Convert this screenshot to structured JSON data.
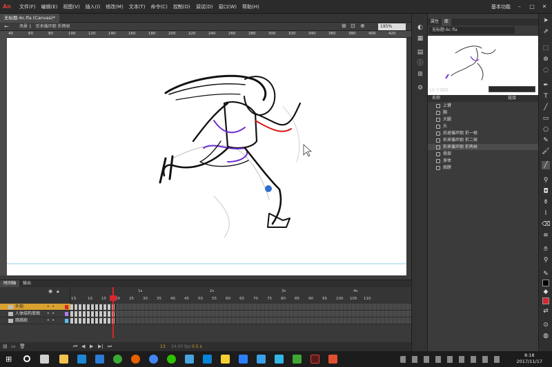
{
  "app": {
    "logo": "An"
  },
  "menu": [
    "文件(F)",
    "编辑(E)",
    "视图(V)",
    "插入(I)",
    "修改(M)",
    "文本(T)",
    "命令(C)",
    "控制(O)",
    "调试(D)",
    "窗口(W)",
    "帮助(H)"
  ],
  "workspace": "基本功能",
  "document": {
    "tab": "无标题-6c.fla (Canvas)*",
    "scene": "场景 1",
    "symbol": "形来循环跑 折两帧",
    "zoom": "195%"
  },
  "ruler_ticks": [
    "40",
    "60",
    "80",
    "100",
    "120",
    "140",
    "160",
    "180",
    "200",
    "220",
    "240",
    "260",
    "280",
    "300",
    "320",
    "340",
    "360",
    "380",
    "400",
    "420"
  ],
  "timeline": {
    "tabs": [
      "时间轴",
      "输出"
    ],
    "frame_numbers": [
      "1",
      "5",
      "10",
      "15",
      "20",
      "25",
      "30",
      "35",
      "40",
      "45",
      "50",
      "55",
      "60",
      "65",
      "70",
      "75",
      "80",
      "85",
      "90",
      "95",
      "100",
      "105",
      "110"
    ],
    "seconds": [
      "1s",
      "2s",
      "3s",
      "4s"
    ],
    "current_frame": "13",
    "fps": "24.00 fps",
    "elapsed": "0.5 s",
    "layers": [
      {
        "name": "外观",
        "selected": true,
        "color": "#d7262d"
      },
      {
        "name": "人体结构草图",
        "selected": false,
        "color": "#b07cf0"
      },
      {
        "name": "跳跳跑",
        "selected": false,
        "color": "#58c0f0"
      }
    ]
  },
  "library": {
    "tabs": [
      "属性",
      "库"
    ],
    "doc": "无标题-6c.fla",
    "count": "10 个项目",
    "col_name": "名称",
    "col_link": "链接",
    "items": [
      "上臂",
      "胸",
      "大腿",
      "头",
      "后退循环跑 折一帧",
      "形来循环跑 折二帧",
      "形来循环跑 折两帧",
      "骨部",
      "身体",
      "肩膀"
    ],
    "selected_index": 6
  },
  "colors": {
    "stroke": "#000000",
    "fill": "#d7262d",
    "accent": "#d9a230"
  },
  "taskbar": {
    "time": "8:18",
    "date": "2017/11/17"
  }
}
